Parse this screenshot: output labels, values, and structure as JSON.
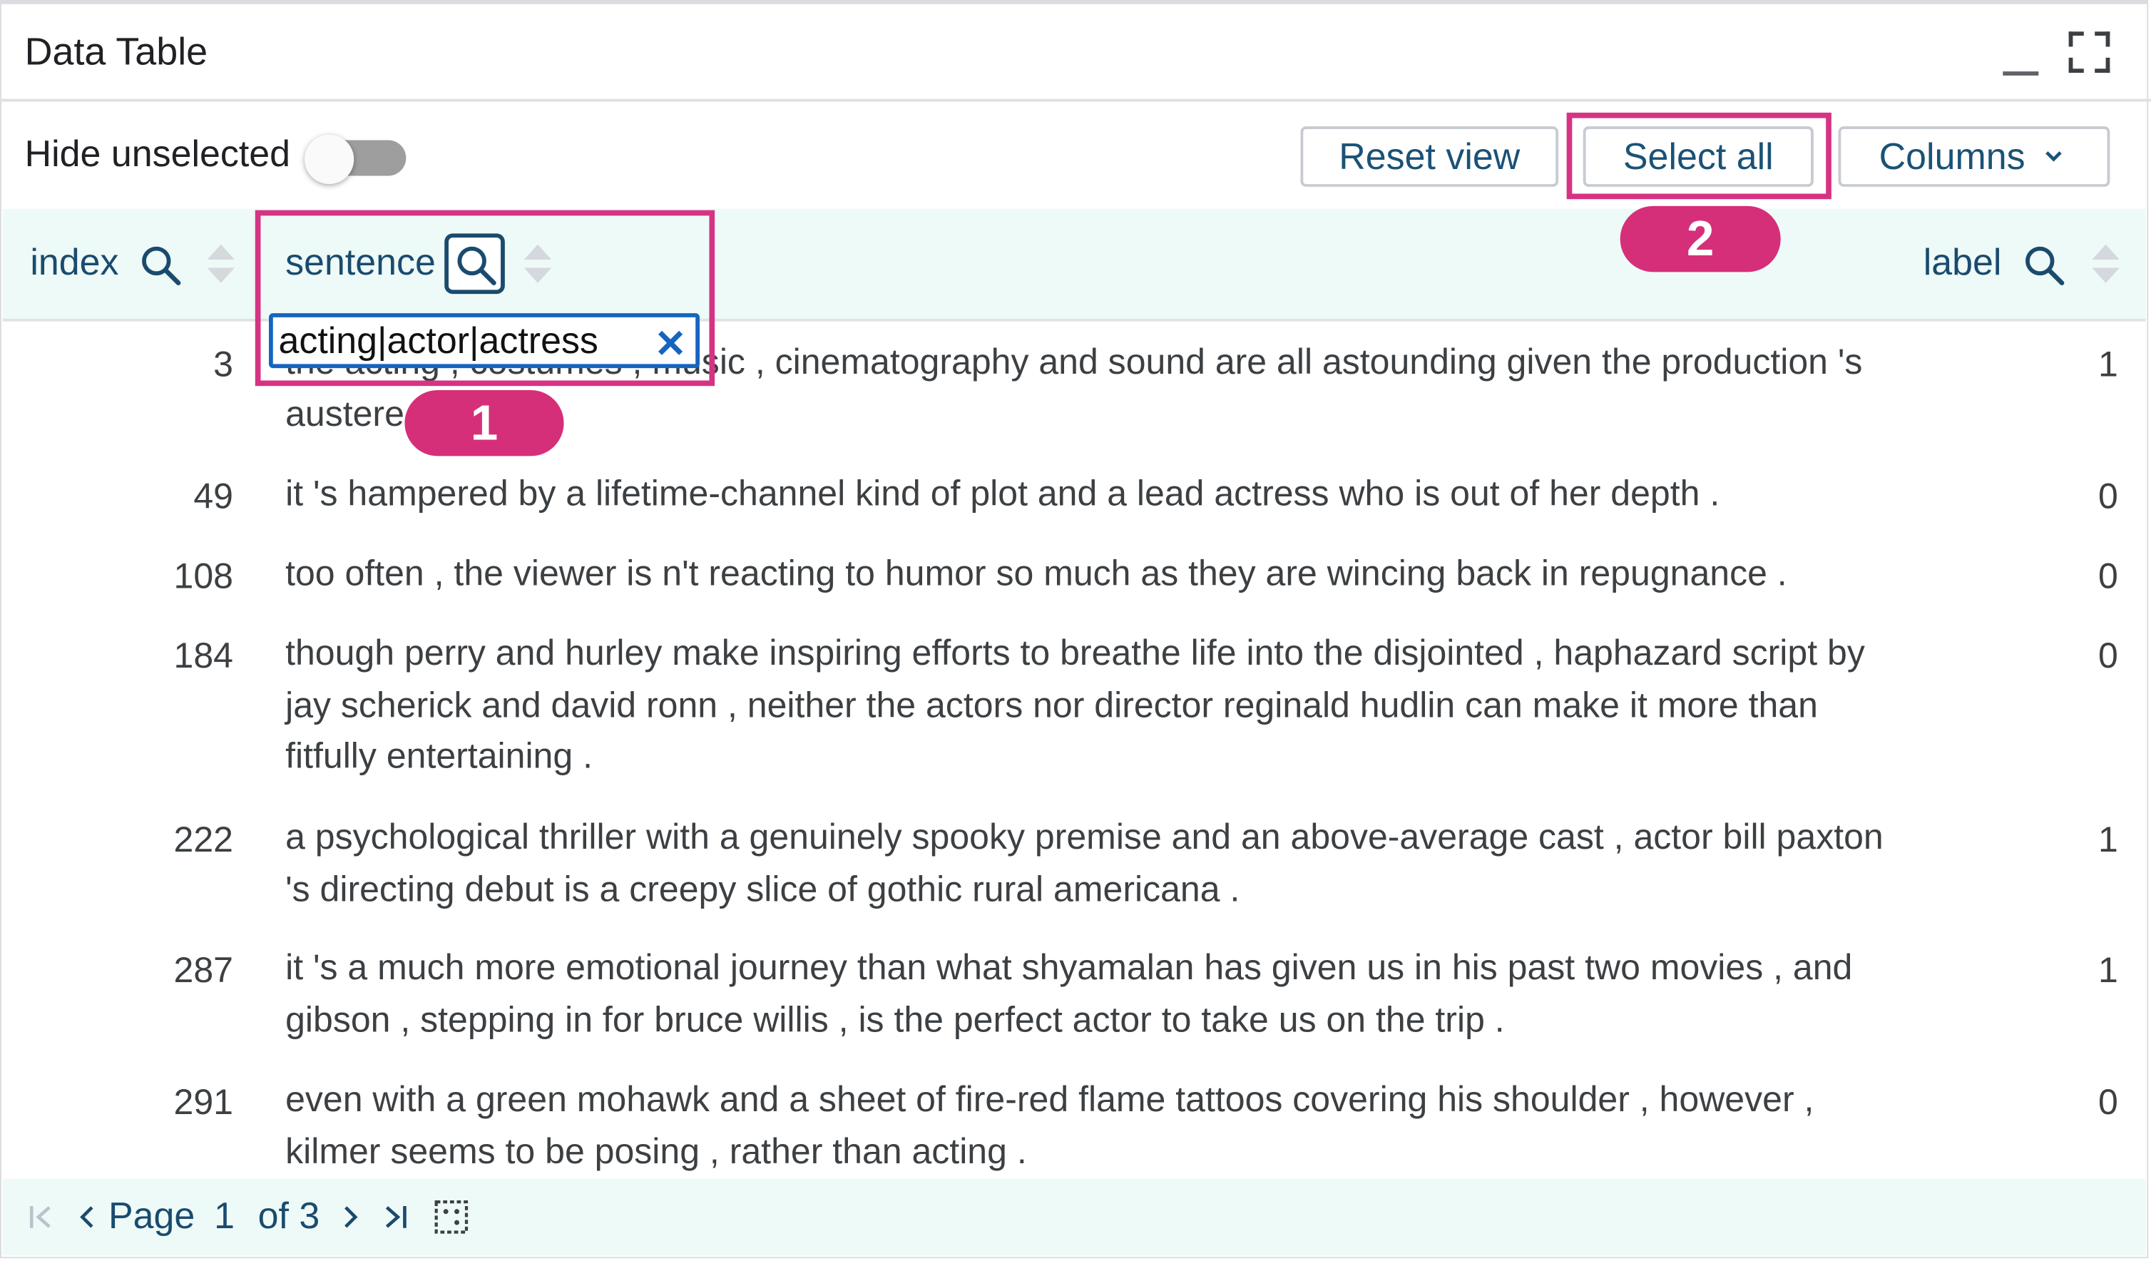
{
  "panel": {
    "title": "Data Table"
  },
  "toolbar": {
    "hide_unselected_label": "Hide unselected",
    "hide_unselected_on": false,
    "reset_view_label": "Reset view",
    "select_all_label": "Select all",
    "columns_label": "Columns"
  },
  "columns": {
    "index": "index",
    "sentence": "sentence",
    "label": "label"
  },
  "filter": {
    "value": "acting|actor|actress",
    "clear_glyph": "✕"
  },
  "rows": [
    {
      "index": "3",
      "sentence": "the acting , costumes , music , cinematography and sound are all astounding given the production 's austere locales .",
      "label": "1"
    },
    {
      "index": "49",
      "sentence": "it 's hampered by a lifetime-channel kind of plot and a lead actress who is out of her depth .",
      "label": "0"
    },
    {
      "index": "108",
      "sentence": "too often , the viewer is n't reacting to humor so much as they are wincing back in repugnance .",
      "label": "0"
    },
    {
      "index": "184",
      "sentence": "though perry and hurley make inspiring efforts to breathe life into the disjointed , haphazard script by jay scherick and david ronn , neither the actors nor director reginald hudlin can make it more than fitfully entertaining .",
      "label": "0"
    },
    {
      "index": "222",
      "sentence": "a psychological thriller with a genuinely spooky premise and an above-average cast , actor bill paxton 's directing debut is a creepy slice of gothic rural americana .",
      "label": "1"
    },
    {
      "index": "287",
      "sentence": "it 's a much more emotional journey than what shyamalan has given us in his past two movies , and gibson , stepping in for bruce willis , is the perfect actor to take us on the trip .",
      "label": "1"
    },
    {
      "index": "291",
      "sentence": "even with a green mohawk and a sheet of fire-red flame tattoos covering his shoulder , however , kilmer seems to be posing , rather than acting .",
      "label": "0"
    }
  ],
  "pagination": {
    "page_word": "Page",
    "current": "1",
    "of_text": "of 3"
  },
  "annotations": [
    {
      "number": "1"
    },
    {
      "number": "2"
    }
  ],
  "colors": {
    "highlight": "#d63384",
    "badge": "#d62f7a",
    "header_bg": "#eefaf8",
    "accent_text": "#1a4b6e",
    "filter_border": "#1565c0"
  }
}
